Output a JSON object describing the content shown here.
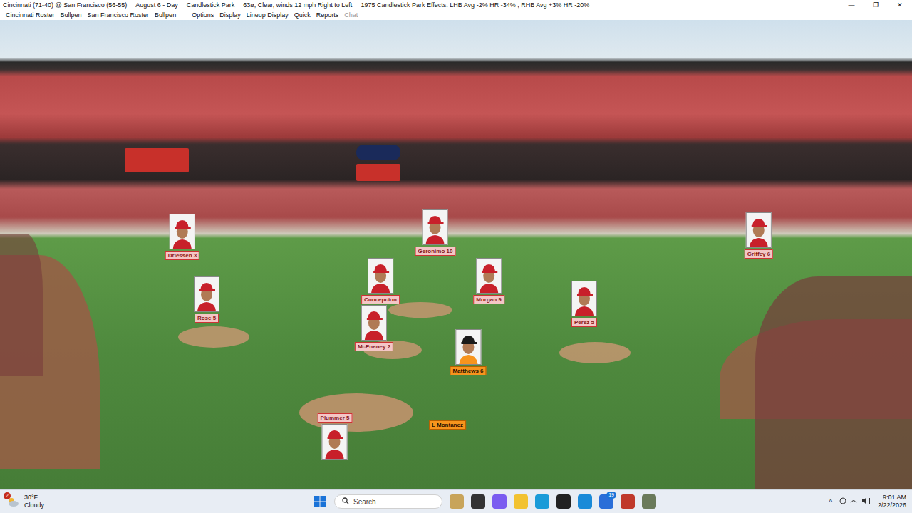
{
  "window": {
    "title_parts": [
      "Cincinnati (71-40) @  San Francisco (56-55)",
      "August 6 - Day",
      "Candlestick Park",
      "63ø, Clear, winds 12 mph Right to Left",
      "1975 Candlestick Park Effects: LHB Avg -2% HR -34% , RHB Avg +3% HR -20%"
    ],
    "controls": [
      "—",
      "❐",
      "✕"
    ]
  },
  "menu": [
    {
      "label": "Cincinnati Roster",
      "disabled": false
    },
    {
      "label": "Bullpen",
      "disabled": false
    },
    {
      "label": "San Francisco Roster",
      "disabled": false
    },
    {
      "label": "Bullpen",
      "disabled": false
    },
    {
      "label": "Options",
      "disabled": false
    },
    {
      "label": "Display",
      "disabled": false
    },
    {
      "label": "Lineup Display",
      "disabled": false
    },
    {
      "label": "Quick",
      "disabled": false
    },
    {
      "label": "Reports",
      "disabled": false
    },
    {
      "label": "Chat",
      "disabled": true
    }
  ],
  "field": {
    "players": [
      {
        "name": "Driessen 3",
        "kind": "card",
        "color": "#f4c6c6"
      },
      {
        "name": "Geronimo 10",
        "kind": "card",
        "color": "#f4c6c6"
      },
      {
        "name": "Griffey 6",
        "kind": "card",
        "color": "#f4c6c6"
      },
      {
        "name": "Rose 5",
        "kind": "card",
        "color": "#f4c6c6"
      },
      {
        "name": "Concepcion",
        "kind": "card",
        "color": "#f4c6c6"
      },
      {
        "name": "Morgan 9",
        "kind": "card",
        "color": "#f4c6c6"
      },
      {
        "name": "McEnaney 2",
        "kind": "card",
        "color": "#f4c6c6"
      },
      {
        "name": "Perez 5",
        "kind": "card",
        "color": "#f4c6c6"
      },
      {
        "name": "Matthews 6",
        "kind": "card",
        "color": "#f7941d"
      },
      {
        "name": "Plummer 5",
        "kind": "card-below",
        "color": "#f4c6c6"
      },
      {
        "name": "L Montanez",
        "kind": "label-only",
        "color": "#f7941d"
      }
    ]
  },
  "taskbar": {
    "weather": {
      "temp": "30°F",
      "condition": "Cloudy",
      "badge": "2"
    },
    "search": "Search",
    "app_badge": "19",
    "tray": "^",
    "time": "9:01 AM",
    "date": "2/22/2026"
  }
}
